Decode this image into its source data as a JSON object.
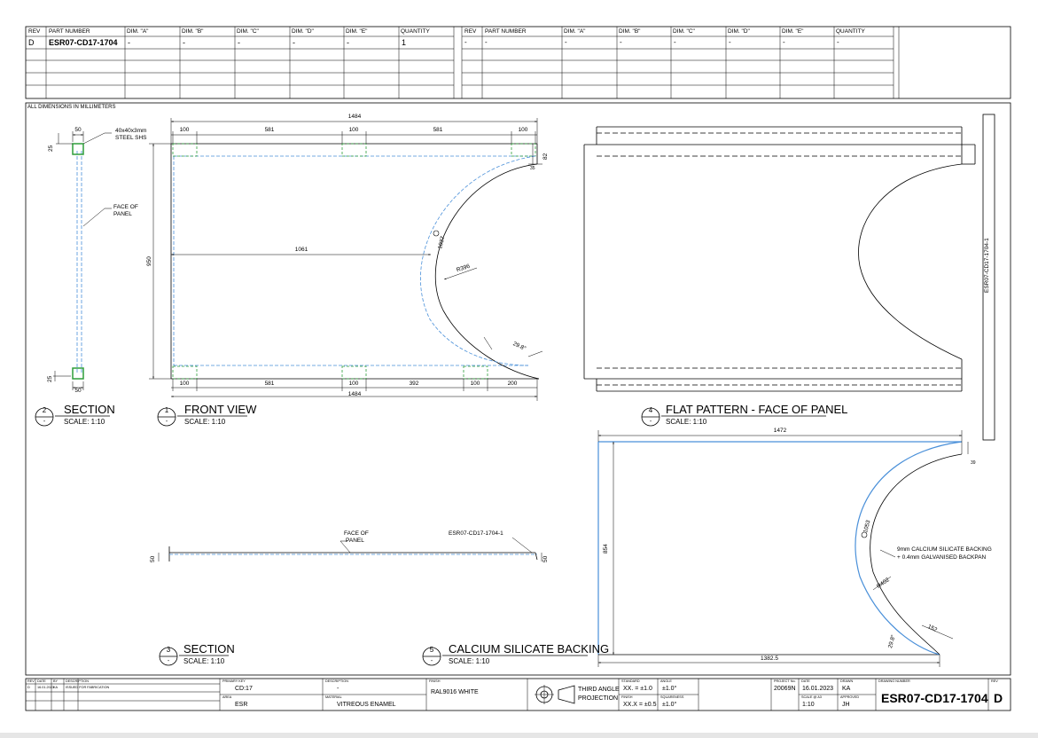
{
  "parts_table_left": {
    "headers": [
      "REV",
      "PART NUMBER",
      "DIM. \"A\"",
      "DIM. \"B\"",
      "DIM. \"C\"",
      "DIM. \"D\"",
      "DIM. \"E\"",
      "QUANTITY"
    ],
    "row": [
      "D",
      "ESR07-CD17-1704",
      "-",
      "-",
      "-",
      "-",
      "-",
      "1"
    ]
  },
  "parts_table_right": {
    "headers": [
      "REV",
      "PART NUMBER",
      "DIM. \"A\"",
      "DIM. \"B\"",
      "DIM. \"C\"",
      "DIM. \"D\"",
      "DIM. \"E\"",
      "QUANTITY"
    ],
    "row": [
      "-",
      "-",
      "-",
      "-",
      "-",
      "-",
      "-",
      "-"
    ]
  },
  "units_note": "ALL DIMENSIONS IN MILLIMETERS",
  "views": {
    "section2": {
      "number": "2",
      "sub": "-",
      "title": "SECTION",
      "scale": "SCALE: 1:10"
    },
    "front": {
      "number": "1",
      "sub": "-",
      "title": "FRONT VIEW",
      "scale": "SCALE: 1:10"
    },
    "flat": {
      "number": "4",
      "sub": "-",
      "title": "FLAT PATTERN - FACE OF PANEL",
      "scale": "SCALE: 1:10"
    },
    "section3": {
      "number": "3",
      "sub": "-",
      "title": "SECTION",
      "scale": "SCALE: 1:10"
    },
    "backing": {
      "number": "5",
      "sub": "-",
      "title": "CALCIUM SILICATE BACKING",
      "scale": "SCALE: 1:10"
    }
  },
  "section_view": {
    "shs_label_1": "40x40x3mm",
    "shs_label_2": "STEEL SHS",
    "face_label_1": "FACE OF",
    "face_label_2": "PANEL",
    "dim_top_width": "50",
    "dim_bottom_width": "50",
    "dim_top_offset": "25",
    "dim_bottom_offset": "25"
  },
  "front_view": {
    "overall_top": "1484",
    "overall_bottom": "1484",
    "top_segments": [
      "100",
      "581",
      "100",
      "581",
      "100"
    ],
    "bottom_segments": [
      "100",
      "581",
      "100",
      "392",
      "100",
      "200"
    ],
    "height": "950",
    "inner_width": "1061",
    "right_offset": "82",
    "arc_length": "1037",
    "radius": "R396",
    "angle": "29.8°",
    "corner_dim": "35"
  },
  "flat_view": {
    "part_label": "ESR07-CD17-1704-1"
  },
  "section3_view": {
    "face_label_1": "FACE OF",
    "face_label_2": "PANEL",
    "part_label": "ESR07-CD17-1704-1",
    "left_height": "50",
    "right_height": "50"
  },
  "backing_view": {
    "overall_top": "1472",
    "overall_bottom": "1382.5",
    "height": "854",
    "arc_length": "1053",
    "radius": "R402",
    "gap": "152",
    "angle": "29.8°",
    "corner_dim": "39",
    "note_1": "9mm CALCIUM SILICATE BACKING",
    "note_2": "+ 0.4mm GALVANISED BACKPAN"
  },
  "title_block": {
    "rev_labels": [
      "REV",
      "DATE",
      "BY",
      "DESCRIPTION"
    ],
    "rev_row": [
      "D",
      "16.01.2023",
      "KA",
      "ISSUED FOR FABRICATION"
    ],
    "primary_key_label": "PRIMARY KEY",
    "primary_key": "CD:17",
    "area_label": "AREA",
    "area": "ESR",
    "description_label": "DESCRIPTION",
    "description": "-",
    "material_label": "MATERIAL",
    "material": "VITREOUS ENAMEL",
    "finish_label": "FINISH",
    "finish": "RAL9016 WHITE",
    "projection_1": "THIRD ANGLE",
    "projection_2": "PROJECTION",
    "tol_std_label": "STANDARD",
    "tol_xx": "XX.  = ±1.0",
    "tol_xxx_label": "FINISH",
    "tol_xxx": "XX.X = ±0.5",
    "angle_label": "ANGLE",
    "angle_tol": "±1.0°",
    "squareness_label": "SQUARENESS",
    "squareness_tol": "±1.0°",
    "project_label": "PROJECT No.",
    "project": "20069N",
    "date_label": "DATE",
    "date": "16.01.2023",
    "drawn_label": "DRAWN",
    "drawn": "KA",
    "scale_label": "SCALE @ A3",
    "scale": "1:10",
    "approved_label": "APPROVED",
    "approved": "JH",
    "drawing_number_label": "DRAWING NUMBER",
    "drawing_number": "ESR07-CD17-1704",
    "rev_label": "REV",
    "rev": "D"
  },
  "colors": {
    "line": "#000000",
    "hidden_blue": "#4a90d9",
    "steel_green": "#2e9e3a"
  }
}
